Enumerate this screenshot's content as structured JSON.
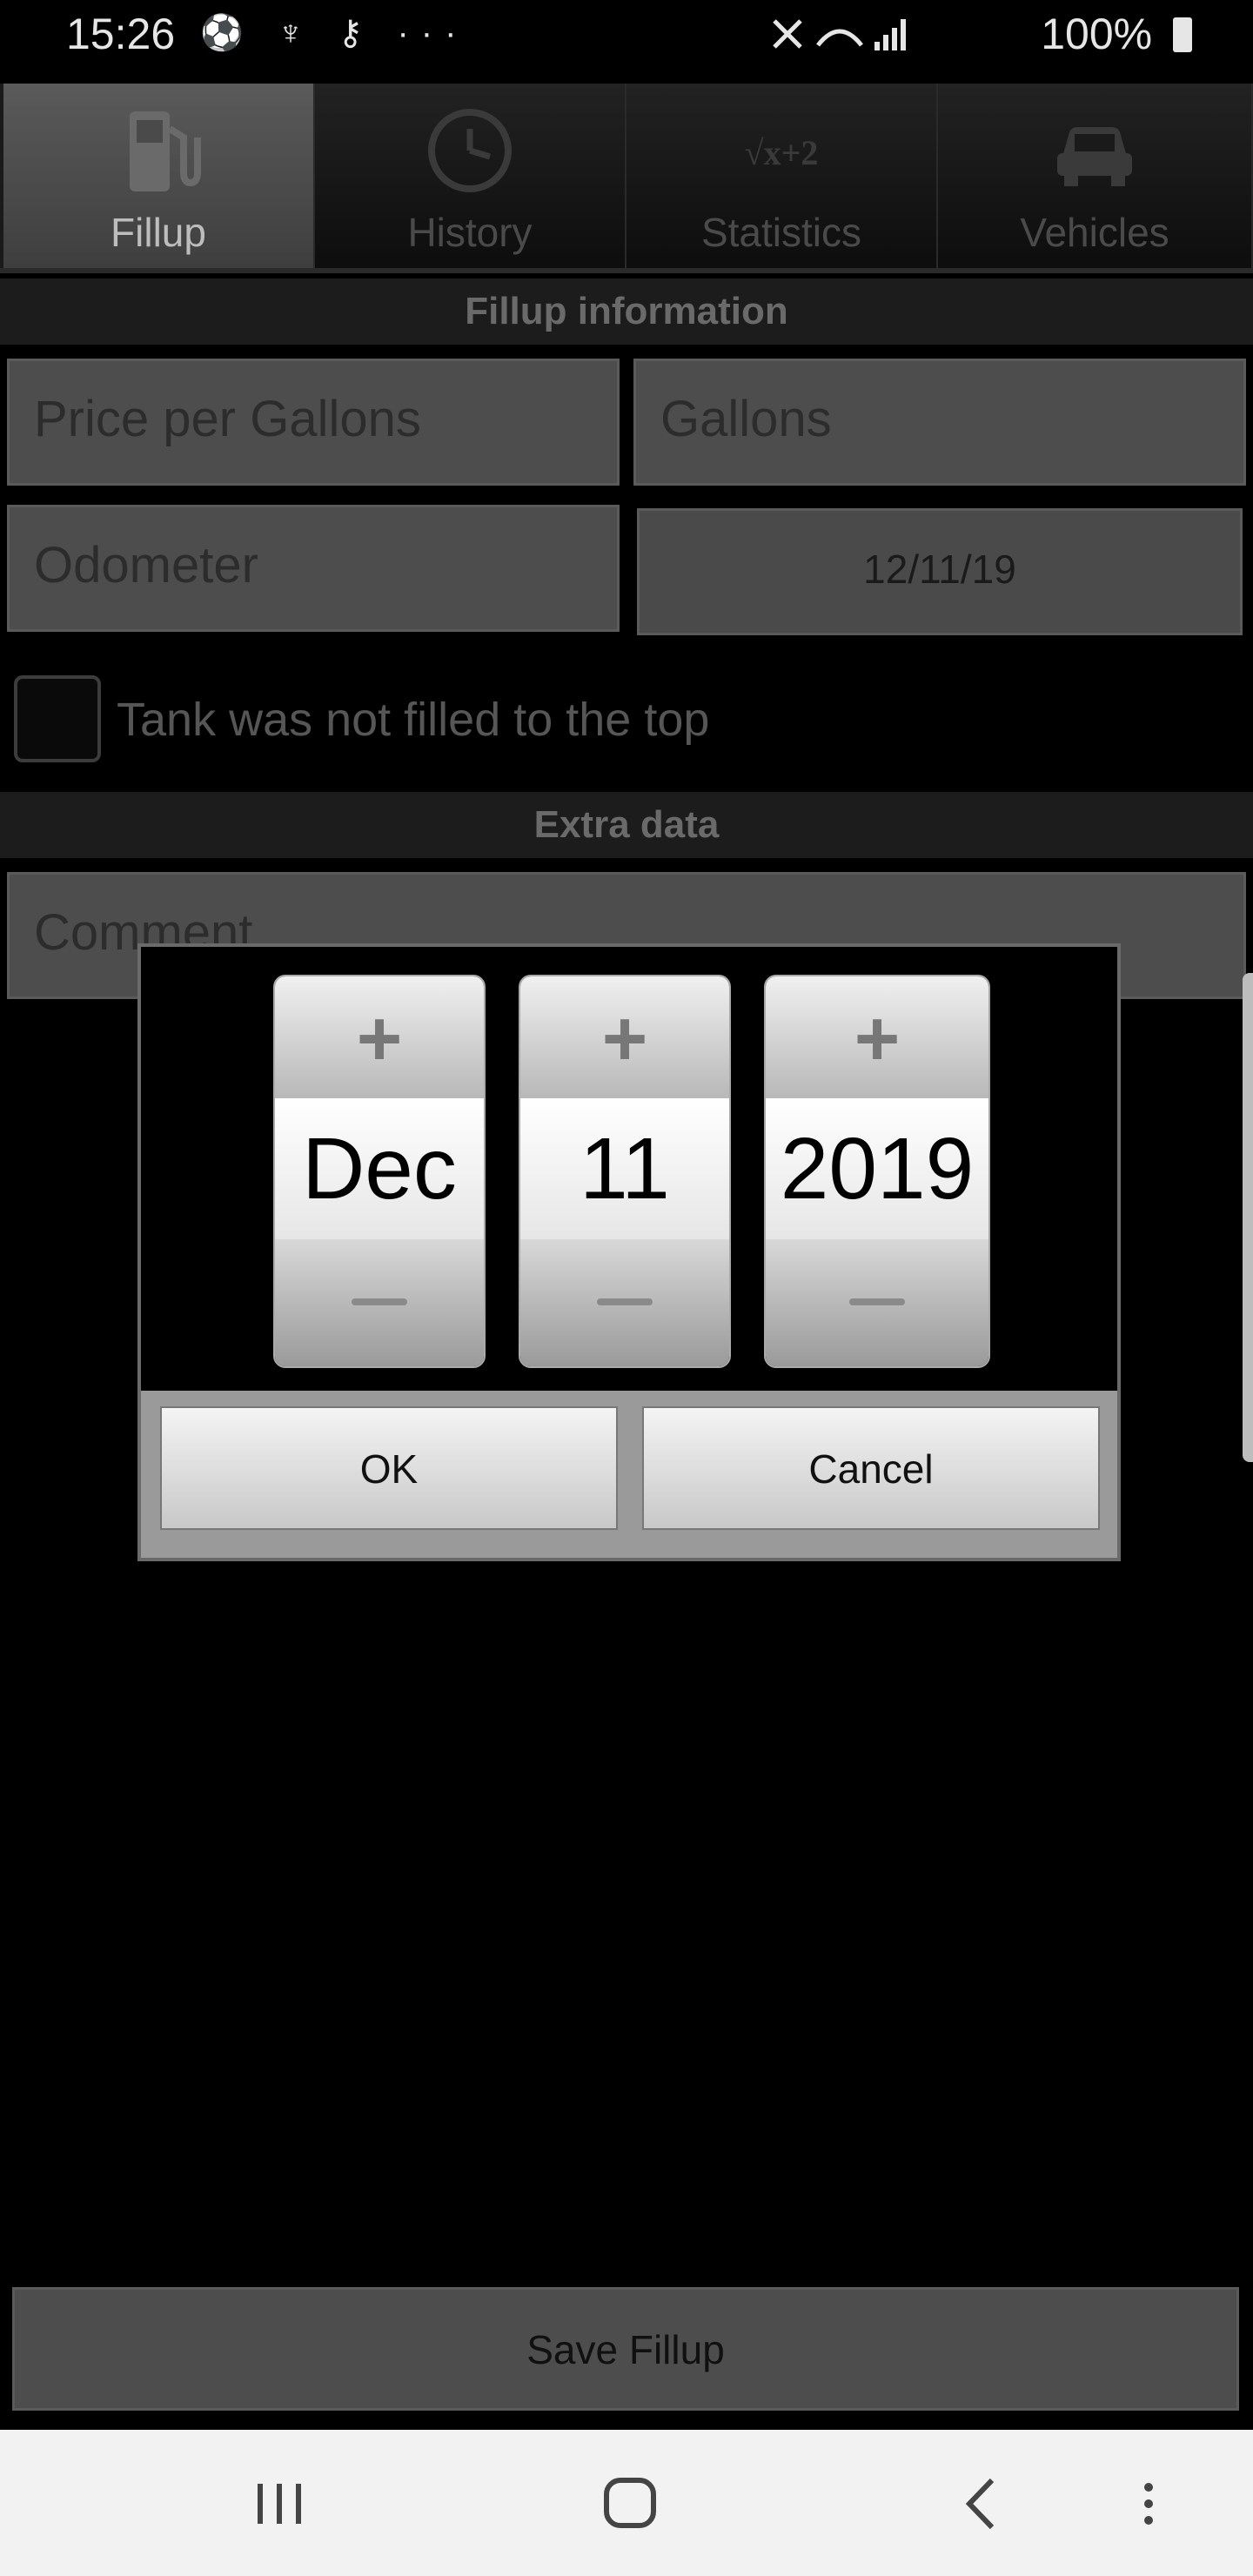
{
  "status_bar": {
    "time": "15:26",
    "left_icons": "⚽ ♆ ⚷ ···",
    "signal": "✈",
    "battery": "100%"
  },
  "tabs": [
    {
      "label": "Fillup",
      "icon": "fuel-pump-icon",
      "active": true
    },
    {
      "label": "History",
      "icon": "clock-icon",
      "active": false
    },
    {
      "label": "Statistics",
      "icon": "sqrt-formula-icon",
      "active": false
    },
    {
      "label": "Vehicles",
      "icon": "car-icon",
      "active": false
    }
  ],
  "statistics_icon_text": "√x+2",
  "sections": {
    "fillup_info": "Fillup information",
    "extra_data": "Extra data"
  },
  "fields": {
    "price_placeholder": "Price per Gallons",
    "gallons_placeholder": "Gallons",
    "odometer_placeholder": "Odometer",
    "date_value": "12/11/19",
    "comment_placeholder": "Comment"
  },
  "checkbox": {
    "label": "Tank was not filled to the top",
    "checked": false
  },
  "date_picker": {
    "month": "Dec",
    "day": "11",
    "year": "2019",
    "plus": "+",
    "ok": "OK",
    "cancel": "Cancel"
  },
  "save_button": "Save Fillup"
}
